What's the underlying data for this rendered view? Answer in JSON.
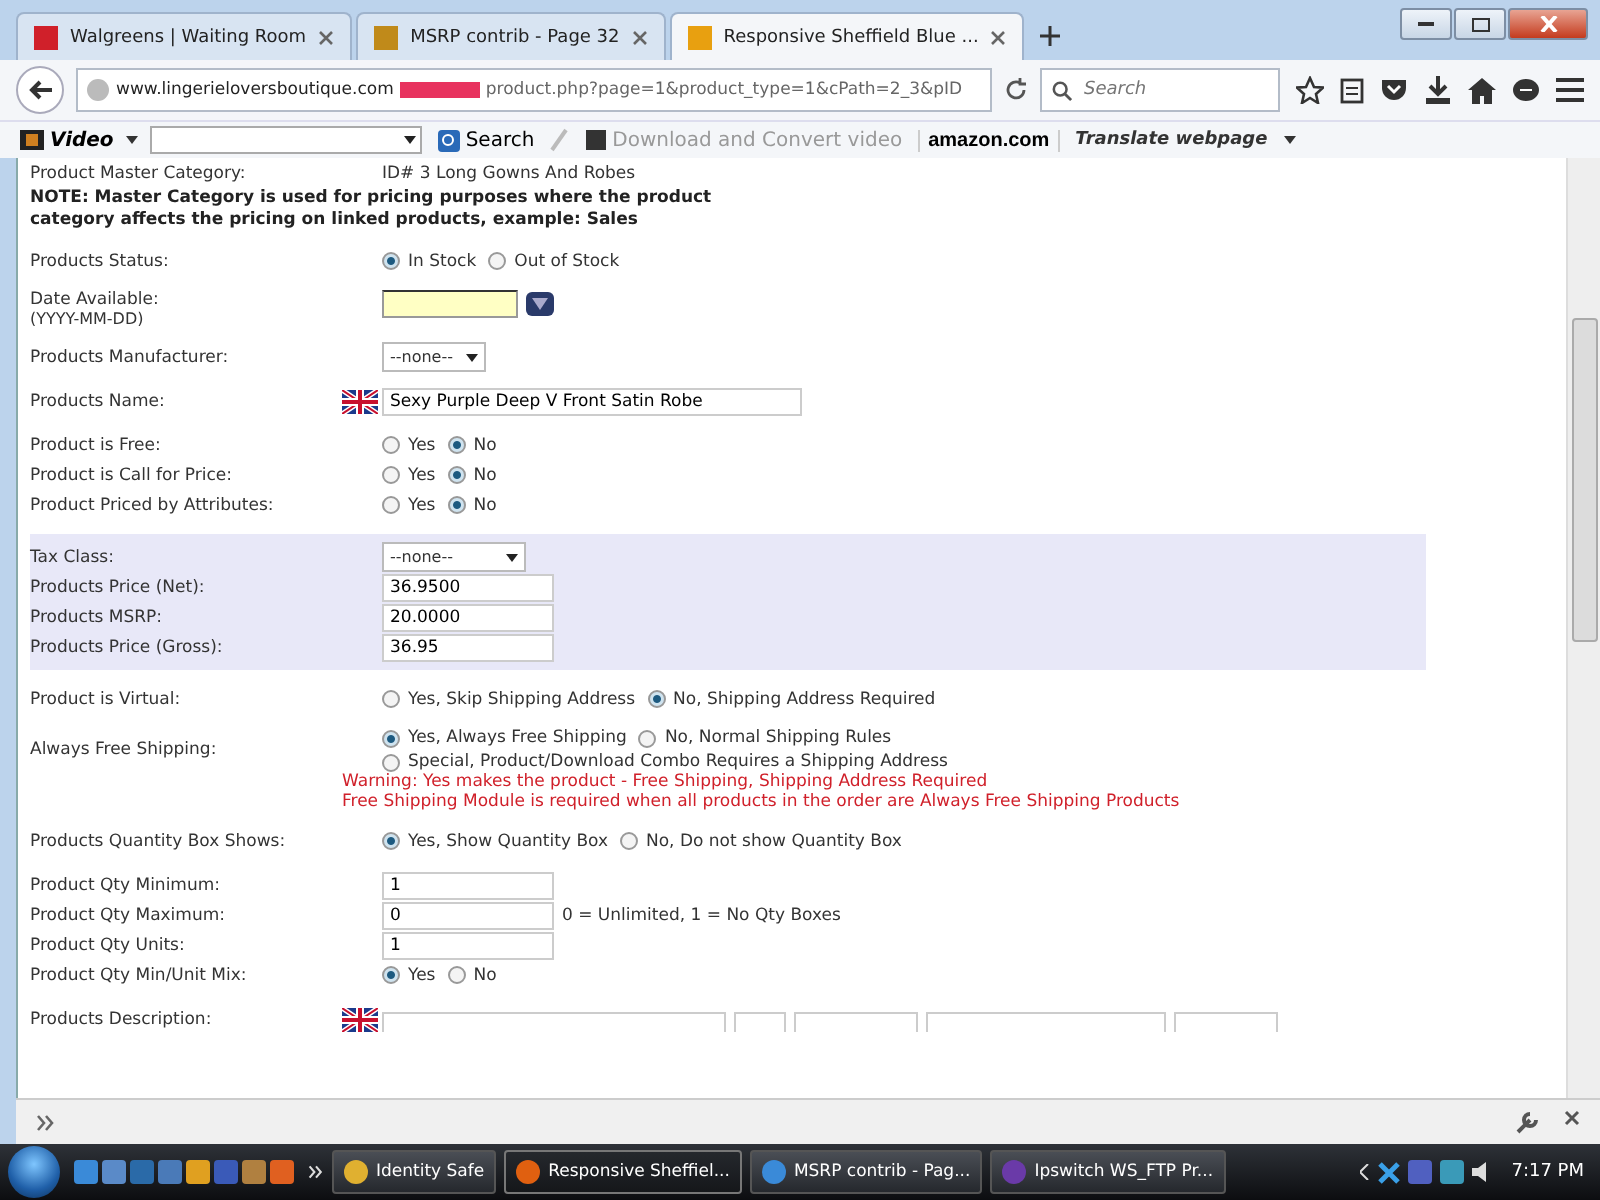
{
  "browser": {
    "tabs": [
      {
        "title": "Walgreens | Waiting Room",
        "selected": false
      },
      {
        "title": "MSRP contrib - Page 32",
        "selected": false
      },
      {
        "title": "Responsive Sheffield Blue ...",
        "selected": true
      }
    ],
    "url": {
      "host": "www.lingerieloversboutique.com",
      "path": "product.php?page=1&product_type=1&cPath=2_3&pID"
    },
    "search_placeholder": "Search"
  },
  "toolbar": {
    "video_label": "Video",
    "search_button": "Search",
    "download_button": "Download and Convert video",
    "amazon_logo": "amazon.com",
    "translate_button": "Translate webpage"
  },
  "form": {
    "sections": [
      {
        "shaded": false,
        "rows": [
          {
            "kind": "text",
            "label": "Product Master Category:",
            "value": "ID# 3 Long Gowns And Robes"
          },
          {
            "kind": "note",
            "text": "NOTE: Master Category is used for pricing purposes where the product category affects the pricing on linked products, example: Sales"
          }
        ]
      },
      {
        "shaded": false,
        "rows": [
          {
            "kind": "radios",
            "label": "Products Status:",
            "options": [
              {
                "label": "In Stock",
                "selected": true
              },
              {
                "label": "Out of Stock",
                "selected": false
              }
            ]
          }
        ]
      },
      {
        "shaded": false,
        "rows": [
          {
            "kind": "date",
            "label": "Date Available:",
            "hint": "(YYYY-MM-DD)"
          }
        ]
      },
      {
        "shaded": false,
        "rows": [
          {
            "kind": "select",
            "label": "Products Manufacturer:",
            "value": "--none--"
          }
        ]
      },
      {
        "shaded": false,
        "rows": [
          {
            "kind": "name",
            "label": "Products Name:",
            "value": "Sexy Purple Deep V Front Satin Robe"
          }
        ]
      },
      {
        "shaded": false,
        "rows": [
          {
            "kind": "radios",
            "label": "Product is Free:",
            "options": [
              {
                "label": "Yes",
                "selected": false
              },
              {
                "label": "No",
                "selected": true
              }
            ]
          },
          {
            "kind": "radios",
            "label": "Product is Call for Price:",
            "options": [
              {
                "label": "Yes",
                "selected": false
              },
              {
                "label": "No",
                "selected": true
              }
            ]
          },
          {
            "kind": "radios",
            "label": "Product Priced by Attributes:",
            "options": [
              {
                "label": "Yes",
                "selected": false
              },
              {
                "label": "No",
                "selected": true
              }
            ]
          }
        ]
      },
      {
        "shaded": true,
        "rows": [
          {
            "kind": "select",
            "label": "Tax Class:",
            "value": "--none--"
          },
          {
            "kind": "input",
            "label": "Products Price (Net):",
            "value": "36.9500"
          },
          {
            "kind": "input",
            "label": "Products MSRP:",
            "value": "20.0000"
          },
          {
            "kind": "input",
            "label": "Products Price (Gross):",
            "value": "36.95"
          }
        ]
      },
      {
        "shaded": false,
        "rows": [
          {
            "kind": "radios",
            "label": "Product is Virtual:",
            "options": [
              {
                "label": "Yes, Skip Shipping Address",
                "selected": false
              },
              {
                "label": "No, Shipping Address Required",
                "selected": true
              }
            ]
          }
        ]
      },
      {
        "shaded": false,
        "rows": [
          {
            "kind": "radios",
            "label": "Always Free Shipping:",
            "options": [
              {
                "label": "Yes, Always Free Shipping",
                "selected": true
              },
              {
                "label": "No, Normal Shipping Rules",
                "selected": false
              },
              {
                "label": "Special, Product/Download Combo Requires a Shipping Address",
                "selected": false
              }
            ]
          },
          {
            "kind": "warning",
            "lines": [
              "Warning: Yes makes the product - Free Shipping, Shipping Address Required",
              "Free Shipping Module is required when all products in the order are Always Free Shipping Products"
            ]
          }
        ]
      },
      {
        "shaded": false,
        "rows": [
          {
            "kind": "radios",
            "label": "Products Quantity Box Shows:",
            "options": [
              {
                "label": "Yes, Show Quantity Box",
                "selected": true
              },
              {
                "label": "No, Do not show Quantity Box",
                "selected": false
              }
            ]
          }
        ]
      },
      {
        "shaded": false,
        "rows": [
          {
            "kind": "input",
            "label": "Product Qty Minimum:",
            "value": "1"
          },
          {
            "kind": "input",
            "label": "Product Qty Maximum:",
            "value": "0",
            "note": "0 = Unlimited, 1 = No Qty Boxes"
          },
          {
            "kind": "input",
            "label": "Product Qty Units:",
            "value": "1"
          },
          {
            "kind": "radios",
            "label": "Product Qty Min/Unit Mix:",
            "options": [
              {
                "label": "Yes",
                "selected": true
              },
              {
                "label": "No",
                "selected": false
              }
            ]
          }
        ]
      },
      {
        "shaded": false,
        "rows": [
          {
            "kind": "editor",
            "label": "Products Description:"
          }
        ]
      }
    ]
  },
  "taskbar": {
    "tasks": [
      {
        "title": "Identity Safe",
        "selected": false
      },
      {
        "title": "Responsive Sheffiel...",
        "selected": true
      },
      {
        "title": "MSRP contrib - Pag...",
        "selected": false
      },
      {
        "title": "Ipswitch WS_FTP Pr...",
        "selected": false
      }
    ],
    "clock": "7:17 PM"
  }
}
